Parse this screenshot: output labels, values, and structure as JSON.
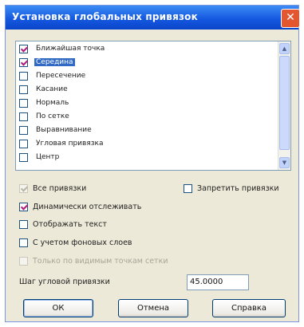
{
  "window": {
    "title": "Установка глобальных привязок",
    "close_symbol": "✕"
  },
  "snap_list": {
    "items": [
      {
        "label": "Ближайшая точка",
        "checked": true,
        "selected": false
      },
      {
        "label": "Середина",
        "checked": true,
        "selected": true
      },
      {
        "label": "Пересечение",
        "checked": false,
        "selected": false
      },
      {
        "label": "Касание",
        "checked": false,
        "selected": false
      },
      {
        "label": "Нормаль",
        "checked": false,
        "selected": false
      },
      {
        "label": "По сетке",
        "checked": false,
        "selected": false
      },
      {
        "label": "Выравнивание",
        "checked": false,
        "selected": false
      },
      {
        "label": "Угловая привязка",
        "checked": false,
        "selected": false
      },
      {
        "label": "Центр",
        "checked": false,
        "selected": false
      }
    ],
    "scroll_up": "▲",
    "scroll_down": "▼"
  },
  "options": {
    "all_snaps": {
      "label": "Все привязки",
      "checked": true,
      "disabled": true
    },
    "disable_snaps": {
      "label": "Запретить привязки",
      "checked": false,
      "disabled": false
    },
    "dynamic_tracking": {
      "label": "Динамически отслеживать",
      "checked": true,
      "disabled": false
    },
    "show_text": {
      "label": "Отображать текст",
      "checked": false,
      "disabled": false
    },
    "background_layers": {
      "label": "С учетом фоновых слоев",
      "checked": false,
      "disabled": false
    },
    "only_visible_points": {
      "label": "Только по видимым точкам сетки",
      "checked": false,
      "disabled": true
    }
  },
  "angle_step": {
    "label": "Шаг угловой привязки",
    "value": "45.0000"
  },
  "buttons": {
    "ok": "ОК",
    "cancel": "Отмена",
    "help": "Справка"
  }
}
